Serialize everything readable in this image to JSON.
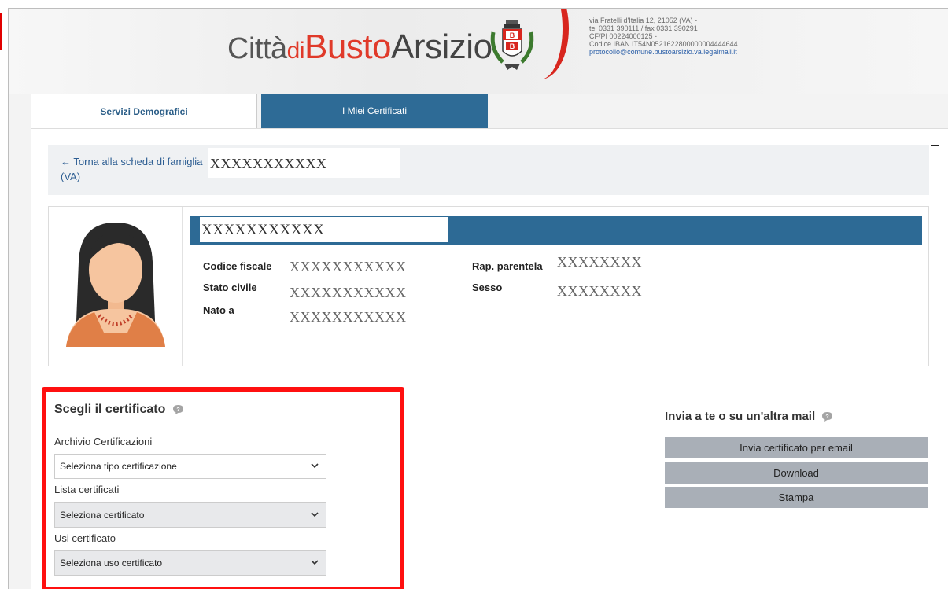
{
  "header": {
    "brand_citta": "Città",
    "brand_di": "di",
    "brand_busto": "Busto",
    "brand_arsizio": "Arsizio",
    "address_lines": [
      "via Fratelli d'Italia 12, 21052 (VA) -",
      "tel 0331 390111 / fax 0331 390291",
      "CF/PI 00224000125 -",
      "Codice IBAN IT54N0521622800000004444644",
      "protocollo@comune.bustoarsizio.va.legalmail.it"
    ]
  },
  "tabs": [
    {
      "label": "Servizi Demografici",
      "active": true
    },
    {
      "label": "I Miei Certificati",
      "active": false
    }
  ],
  "back": {
    "link_text": "Torna alla scheda di famiglia (VA)",
    "masked_text": "XXXXXXXXXXX"
  },
  "person": {
    "name_masked": "XXXXXXXXXXX",
    "fields": {
      "codice_fiscale_label": "Codice fiscale",
      "codice_fiscale_value": "XXXXXXXXXXX",
      "stato_civile_label": "Stato civile",
      "stato_civile_value": "XXXXXXXXXXX",
      "nato_a_label": "Nato a",
      "nato_a_value": "XXXXXXXXXXX",
      "rap_parentela_label": "Rap. parentela",
      "rap_parentela_value": "XXXXXXXX",
      "sesso_label": "Sesso",
      "sesso_value": "XXXXXXXX"
    }
  },
  "certificate": {
    "title": "Scegli il certificato",
    "archivio_label": "Archivio Certificazioni",
    "archivio_value": "Seleziona tipo certificazione",
    "lista_label": "Lista certificati",
    "lista_value": "Seleziona certificato",
    "usi_label": "Usi certificato",
    "usi_value": "Seleziona uso certificato"
  },
  "send": {
    "title": "Invia a te o su un'altra mail",
    "email_button": "Invia certificato per email",
    "download_button": "Download",
    "print_button": "Stampa"
  },
  "colors": {
    "primary_blue": "#2d6a95",
    "highlight_red": "#ff1010",
    "brand_red": "#e03a2a",
    "button_grey": "#a9afb7"
  }
}
